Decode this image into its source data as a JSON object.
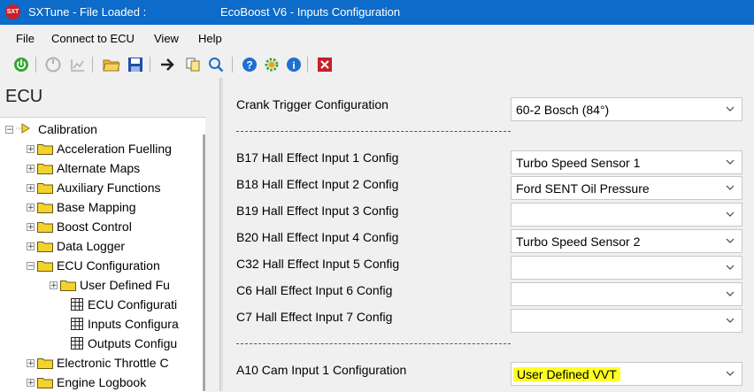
{
  "titlebar": {
    "app_icon_text": "SXT",
    "app_title": "SXTune - File Loaded :",
    "window_title": "EcoBoost V6  - Inputs Configuration"
  },
  "menu": [
    "File",
    "Connect to ECU",
    "View",
    "Help"
  ],
  "toolbar_icons": [
    "power-icon",
    "disconnect-icon",
    "graph-icon",
    "open-folder-icon",
    "save-icon",
    "arrow-icon",
    "copy-icon",
    "search-icon",
    "help-icon",
    "settings-gear-icon",
    "info-icon",
    "close-icon"
  ],
  "left_panel": {
    "header": "ECU",
    "tree": [
      {
        "label": "Calibration",
        "type": "root",
        "expander": "−"
      },
      {
        "label": "Acceleration Fuelling",
        "type": "folder",
        "expander": "+"
      },
      {
        "label": "Alternate Maps",
        "type": "folder",
        "expander": "+"
      },
      {
        "label": "Auxiliary Functions",
        "type": "folder",
        "expander": "+"
      },
      {
        "label": "Base Mapping",
        "type": "folder",
        "expander": "+"
      },
      {
        "label": "Boost Control",
        "type": "folder",
        "expander": "+"
      },
      {
        "label": "Data Logger",
        "type": "folder",
        "expander": "+"
      },
      {
        "label": "ECU Configuration",
        "type": "folder",
        "expander": "−"
      },
      {
        "label": "User Defined Fu",
        "type": "folder",
        "expander": "+"
      },
      {
        "label": "ECU Configurati",
        "type": "grid",
        "expander": ""
      },
      {
        "label": "Inputs Configura",
        "type": "grid",
        "expander": ""
      },
      {
        "label": "Outputs Configu",
        "type": "grid",
        "expander": ""
      },
      {
        "label": "Electronic Throttle C",
        "type": "folder",
        "expander": "+"
      },
      {
        "label": "Engine Logbook",
        "type": "folder",
        "expander": "+"
      }
    ]
  },
  "config": {
    "crank_trigger": {
      "label": "Crank Trigger Configuration",
      "value": "60-2 Bosch (84°)"
    },
    "hall_inputs": [
      {
        "label": "B17 Hall Effect Input 1 Config",
        "value": "Turbo Speed Sensor 1"
      },
      {
        "label": "B18 Hall Effect Input 2 Config",
        "value": "Ford SENT Oil Pressure"
      },
      {
        "label": "B19 Hall Effect Input 3 Config",
        "value": ""
      },
      {
        "label": "B20 Hall Effect Input 4 Config",
        "value": "Turbo Speed Sensor 2"
      },
      {
        "label": "C32 Hall Effect Input 5 Config",
        "value": ""
      },
      {
        "label": "C6 Hall Effect Input 6 Config",
        "value": ""
      },
      {
        "label": "C7 Hall Effect Input 7 Config",
        "value": ""
      }
    ],
    "cam_input": {
      "label": "A10 Cam Input 1 Configuration",
      "value": "User Defined VVT"
    },
    "highlight_color": "#ffff22"
  }
}
